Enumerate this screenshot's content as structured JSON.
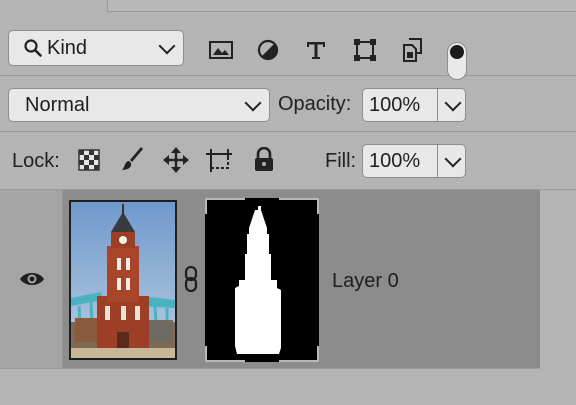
{
  "filter_bar": {
    "kind_label": "Kind",
    "filter_icons": [
      "image-filter-icon",
      "adjustment-filter-icon",
      "type-filter-icon",
      "shape-filter-icon",
      "smart-object-filter-icon"
    ],
    "filter_toggle_on": true
  },
  "blend_bar": {
    "blend_mode": "Normal",
    "opacity_label": "Opacity:",
    "opacity_value": "100%"
  },
  "lock_bar": {
    "lock_label": "Lock:",
    "lock_icons": [
      "lock-transparent-pixels-icon",
      "lock-image-pixels-icon",
      "lock-position-icon",
      "lock-artboard-icon",
      "lock-all-icon"
    ],
    "fill_label": "Fill:",
    "fill_value": "100%"
  },
  "layers": [
    {
      "name": "Layer 0",
      "visible": true,
      "has_mask": true,
      "mask_linked": true
    }
  ],
  "colors": {
    "panel_bg": "#b4b4b4",
    "field_bg": "#e8e8e8",
    "selected_layer_bg": "#8c8c8c"
  }
}
